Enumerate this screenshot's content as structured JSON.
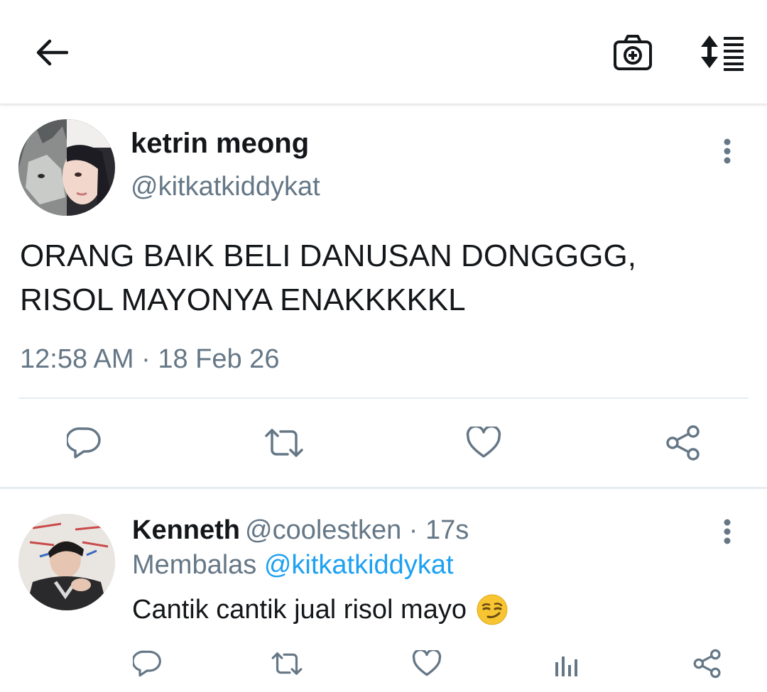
{
  "header": {
    "back_icon": "arrow-left-icon",
    "camera_icon": "camera-plus-icon",
    "sort_icon": "sort-lines-icon"
  },
  "tweet": {
    "author_name": "ketrin meong",
    "author_handle": "@kitkatkiddykat",
    "text_line1": "ORANG BAIK BELI DANUSAN DONGGGG,",
    "text_line2": "RISOL MAYONYA ENAKKKKKL",
    "timestamp": "12:58 AM · 18 Feb 26",
    "actions": [
      "reply-icon",
      "retweet-icon",
      "like-icon",
      "share-icon"
    ]
  },
  "reply": {
    "author_name": "Kenneth",
    "author_handle": "@coolestken",
    "separator": " · ",
    "time": "17s",
    "replying_prefix": "Membalas ",
    "replying_to": "@kitkatkiddykat",
    "text": "Cantik cantik jual risol mayo",
    "emoji": "smirking-face-emoji",
    "actions": [
      "reply-icon",
      "retweet-icon",
      "like-icon",
      "analytics-icon",
      "share-icon"
    ]
  },
  "colors": {
    "text": "#14171a",
    "secondary": "#657786",
    "link": "#1da1f2",
    "divider": "#e6ecf0"
  }
}
